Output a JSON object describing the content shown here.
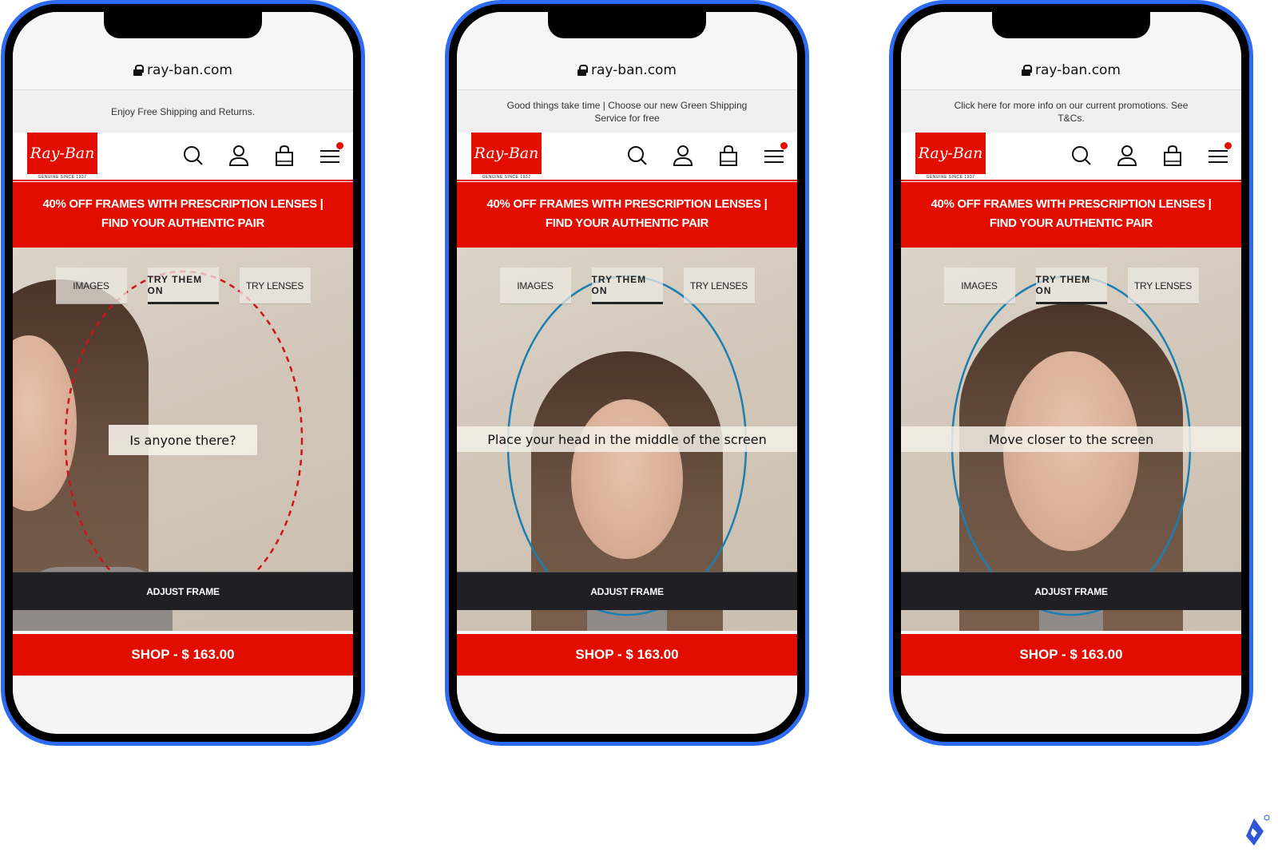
{
  "phones": [
    {
      "url": "ray-ban.com",
      "promo": "Enjoy Free Shipping and Returns.",
      "logo": {
        "text": "Ray-Ban",
        "tagline": "GENUINE SINCE 1937"
      },
      "sale_banner": "40% OFF FRAMES WITH PRESCRIPTION LENSES | FIND YOUR AUTHENTIC PAIR",
      "tabs": [
        {
          "label": "IMAGES",
          "active": false
        },
        {
          "label": "TRY THEM ON",
          "active": true
        },
        {
          "label": "TRY LENSES",
          "active": false
        }
      ],
      "guide": {
        "style": "dashed",
        "color": "#d0121b"
      },
      "message": "Is anyone there?",
      "adjust_label": "ADJUST FRAME",
      "shop_label": "SHOP - $ 163.00"
    },
    {
      "url": "ray-ban.com",
      "promo": "Good things take time | Choose our new Green Shipping Service for free",
      "logo": {
        "text": "Ray-Ban",
        "tagline": "GENUINE SINCE 1937"
      },
      "sale_banner": "40% OFF FRAMES WITH PRESCRIPTION LENSES | FIND YOUR AUTHENTIC PAIR",
      "tabs": [
        {
          "label": "IMAGES",
          "active": false
        },
        {
          "label": "TRY THEM ON",
          "active": true
        },
        {
          "label": "TRY LENSES",
          "active": false
        }
      ],
      "guide": {
        "style": "solid",
        "color": "#1a7fb0"
      },
      "message": "Place your head in the middle of the screen",
      "adjust_label": "ADJUST FRAME",
      "shop_label": "SHOP - $ 163.00"
    },
    {
      "url": "ray-ban.com",
      "promo": "Click here for more info on our current promotions. See T&Cs.",
      "logo": {
        "text": "Ray-Ban",
        "tagline": "GENUINE SINCE 1937"
      },
      "sale_banner": "40% OFF FRAMES WITH PRESCRIPTION LENSES | FIND YOUR AUTHENTIC PAIR",
      "tabs": [
        {
          "label": "IMAGES",
          "active": false
        },
        {
          "label": "TRY THEM ON",
          "active": true
        },
        {
          "label": "TRY LENSES",
          "active": false
        }
      ],
      "guide": {
        "style": "solid",
        "color": "#1a7fb0"
      },
      "message": "Move closer to the screen",
      "adjust_label": "ADJUST FRAME",
      "shop_label": "SHOP - $ 163.00"
    }
  ],
  "colors": {
    "brand_red": "#e20d00",
    "phone_frame": "#2f6bf0",
    "adjust_bar": "#1f1f24"
  },
  "watermark": {
    "icon": "toptal-logo-icon"
  }
}
